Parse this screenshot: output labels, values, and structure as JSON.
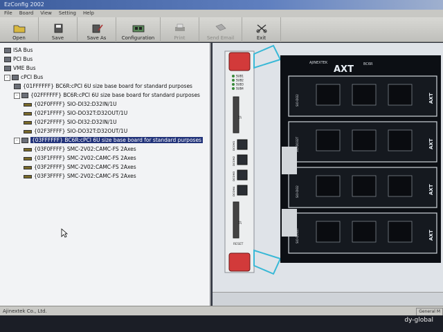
{
  "window": {
    "title": "EzConfig 2002"
  },
  "menu": [
    "File",
    "Board",
    "View",
    "Setting",
    "Help"
  ],
  "toolbar": [
    {
      "label": "Open",
      "icon": "folder-open-icon",
      "enabled": true
    },
    {
      "label": "Save",
      "icon": "disk-icon",
      "enabled": true
    },
    {
      "label": "Save As",
      "icon": "disk-pencil-icon",
      "enabled": true
    },
    {
      "label": "Configuration",
      "icon": "board-config-icon",
      "enabled": true
    },
    {
      "label": "Print",
      "icon": "printer-icon",
      "enabled": false
    },
    {
      "label": "Send Email",
      "icon": "email-icon",
      "enabled": false
    },
    {
      "label": "Exit",
      "icon": "scissors-exit-icon",
      "enabled": true
    }
  ],
  "tree": [
    {
      "level": 0,
      "text": "ISA Bus",
      "icon": "bus-icon"
    },
    {
      "level": 0,
      "text": "PCI Bus",
      "icon": "bus-icon"
    },
    {
      "level": 0,
      "text": "VME Bus",
      "icon": "bus-icon"
    },
    {
      "level": 0,
      "text": "cPCI Bus",
      "icon": "bus-icon",
      "expand": "-"
    },
    {
      "level": 1,
      "text": "{01FFFFFF} BC6R:cPCI 6U size base board for standard purposes",
      "icon": "board-icon"
    },
    {
      "level": 1,
      "text": "{02FFFFFF} BC6R:cPCI 6U size base board for standard purposes",
      "icon": "board-icon",
      "expand": "-"
    },
    {
      "level": 2,
      "text": "{02F0FFFF} SIO-DI32:D32IN/1U",
      "icon": "module-icon"
    },
    {
      "level": 2,
      "text": "{02F1FFFF} SIO-DO32T:D32OUT/1U",
      "icon": "module-icon"
    },
    {
      "level": 2,
      "text": "{02F2FFFF} SIO-DI32:D32IN/1U",
      "icon": "module-icon"
    },
    {
      "level": 2,
      "text": "{02F3FFFF} SIO-DO32T:D32OUT/1U",
      "icon": "module-icon"
    },
    {
      "level": 1,
      "text": "{03FFFFFF} BC6R:cPCI 6U size base board for standard purposes",
      "icon": "board-icon",
      "expand": "-",
      "selected": true
    },
    {
      "level": 2,
      "text": "{03F0FFFF} SMC-2V02:CAMC-FS 2Axes",
      "icon": "module-icon"
    },
    {
      "level": 2,
      "text": "{03F1FFFF} SMC-2V02:CAMC-FS 2Axes",
      "icon": "module-icon"
    },
    {
      "level": 2,
      "text": "{03F2FFFF} SMC-2V02:CAMC-FS 2Axes",
      "icon": "module-icon"
    },
    {
      "level": 2,
      "text": "{03F3FFFF} SMC-2V02:CAMC-FS 2Axes",
      "icon": "module-icon"
    }
  ],
  "board": {
    "brand": "AJINEXTEK",
    "logo": "AXT",
    "model": "BC6R",
    "leds": [
      "SUB1",
      "SUB2",
      "SUB3",
      "SUB4"
    ],
    "ports": [
      "DCOM1",
      "DCOM2",
      "DCOM3",
      "DCOM4"
    ],
    "connectors": [
      "1F",
      "2F"
    ],
    "reset_label": "RESET",
    "module_labels": [
      "SIO-DI32",
      "SIO-DO32T",
      "SIO-DI32",
      "SIO-DO32T"
    ],
    "colors": {
      "pcb": "#0c0f14",
      "handle_red": "#d23a3a",
      "rail": "#38b8d6",
      "panel": "#e8eaec"
    }
  },
  "status": {
    "company": "Ajinextek Co., Ltd.",
    "mode": "General M"
  },
  "watermark": "dy-global"
}
